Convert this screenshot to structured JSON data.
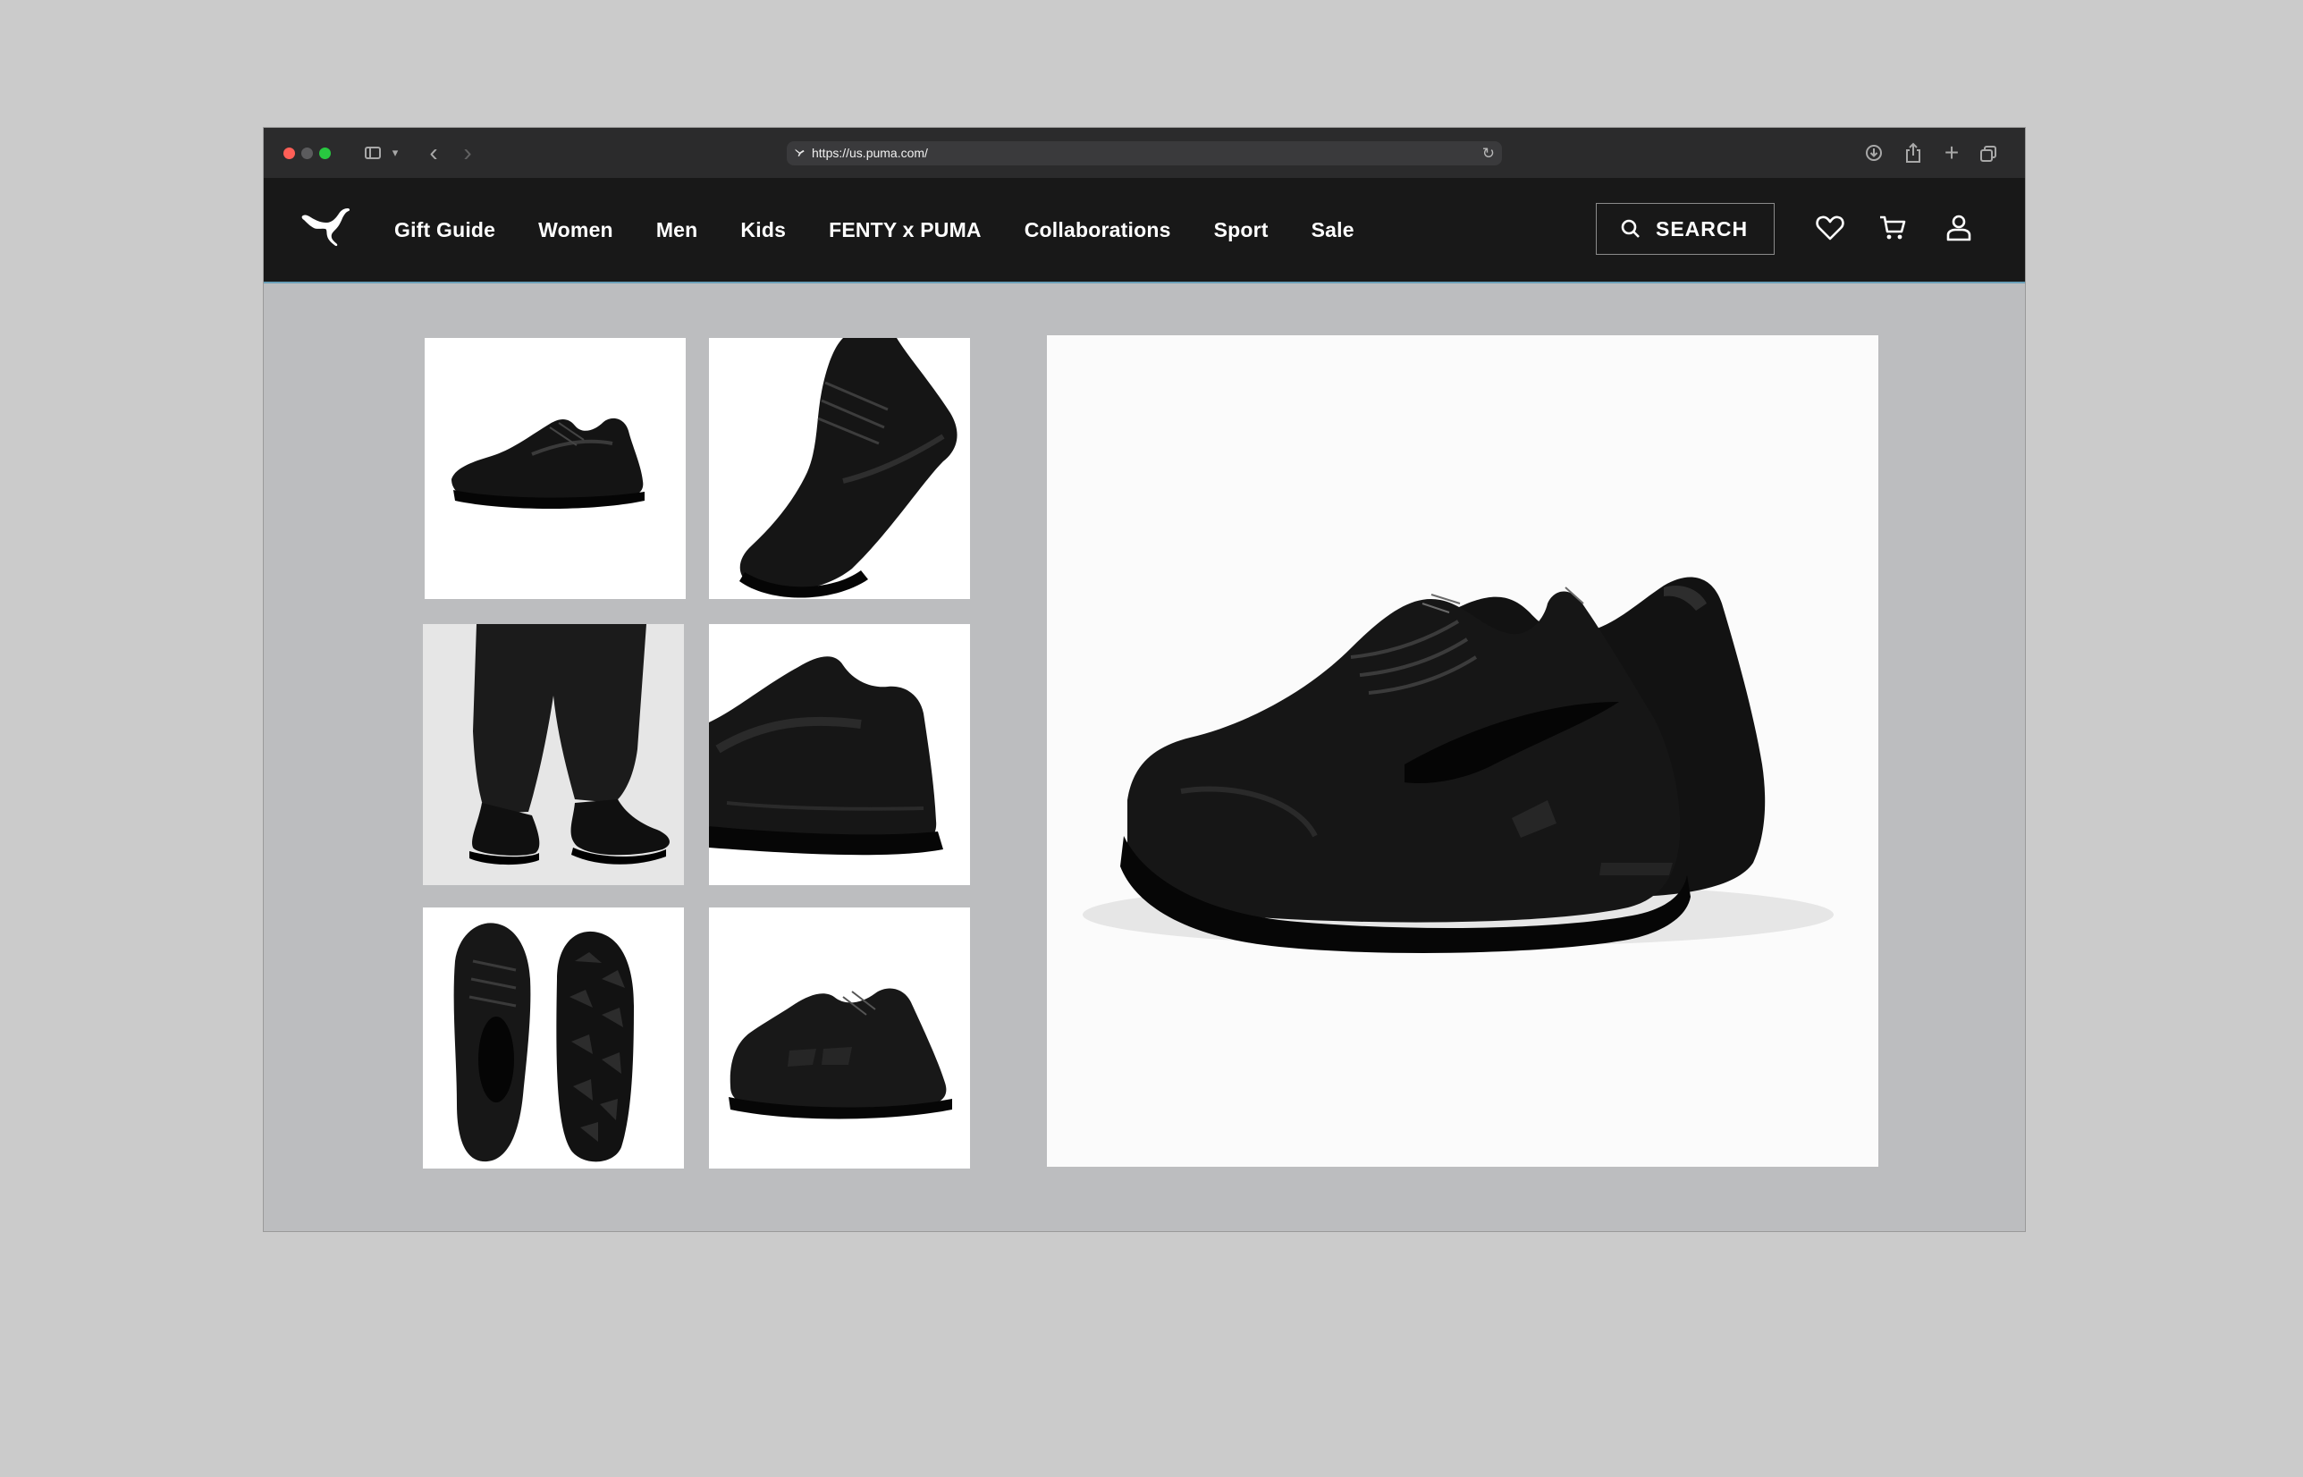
{
  "browser": {
    "url": "https://us.puma.com/"
  },
  "nav": {
    "links": [
      "Gift Guide",
      "Women",
      "Men",
      "Kids",
      "FENTY x PUMA",
      "Collaborations",
      "Sport",
      "Sale"
    ],
    "search_label": "SEARCH"
  },
  "gallery": {
    "thumb_icons": [
      "shoe-side-view",
      "shoe-angled-view",
      "shoe-on-model-view",
      "shoe-heel-view",
      "shoe-top-and-sole-view",
      "shoe-side-view-alt"
    ]
  },
  "colors": {
    "nav_bg": "#181818",
    "page_bg": "#bcbdbf",
    "shoe": "#141414"
  }
}
